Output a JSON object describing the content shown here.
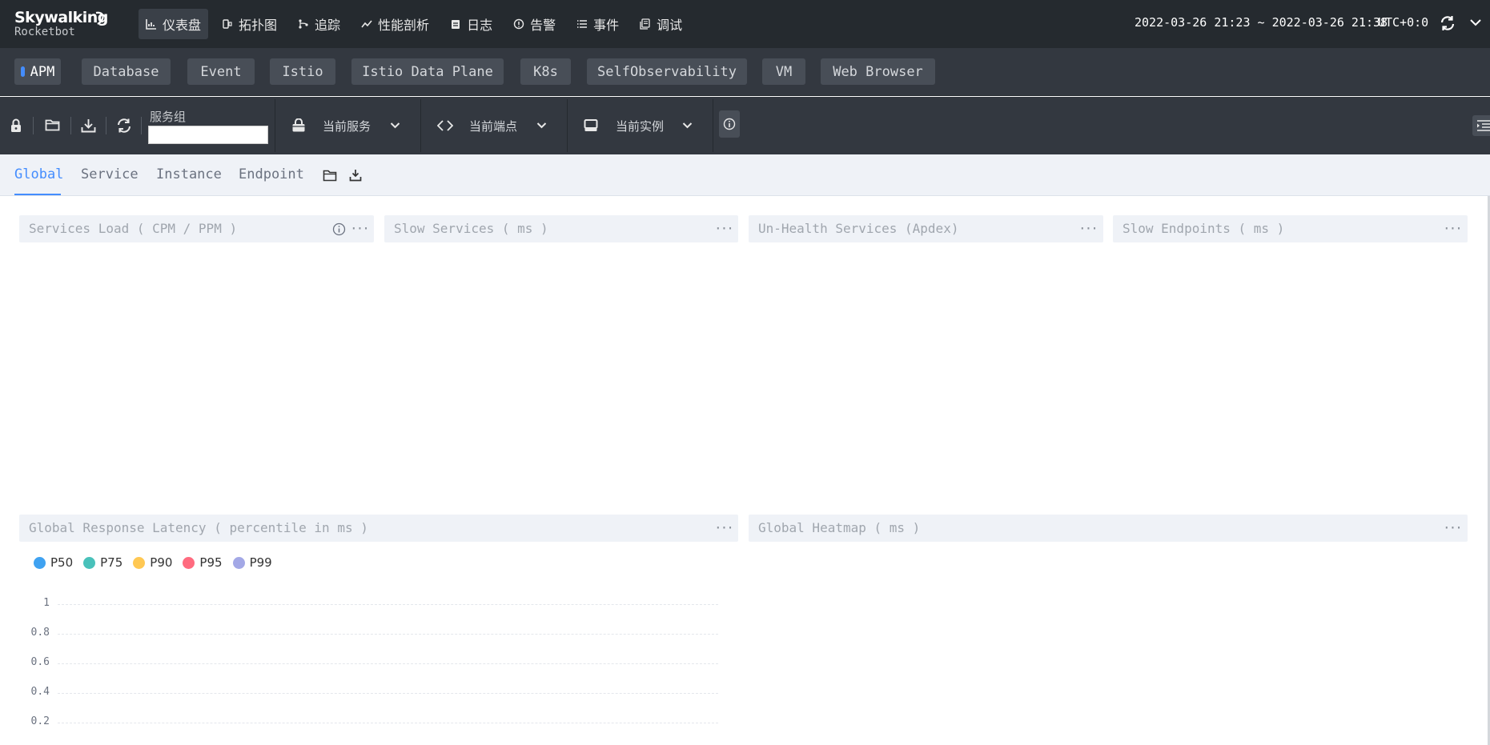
{
  "app": {
    "logo_main": "Skywalking",
    "logo_sub": "Rocketbot"
  },
  "nav": [
    {
      "label": "仪表盘",
      "icon": "dashboard-icon",
      "active": true
    },
    {
      "label": "拓扑图",
      "icon": "topology-icon",
      "active": false
    },
    {
      "label": "追踪",
      "icon": "trace-icon",
      "active": false
    },
    {
      "label": "性能剖析",
      "icon": "profile-icon",
      "active": false
    },
    {
      "label": "日志",
      "icon": "log-icon",
      "active": false
    },
    {
      "label": "告警",
      "icon": "alarm-icon",
      "active": false
    },
    {
      "label": "事件",
      "icon": "event-icon",
      "active": false
    },
    {
      "label": "调试",
      "icon": "debug-icon",
      "active": false
    }
  ],
  "header": {
    "time_range": "2022-03-26 21:23 ~ 2022-03-26 21:38",
    "timezone": "UTC+0:0"
  },
  "layers": [
    {
      "label": "APM",
      "active": true
    },
    {
      "label": "Database",
      "active": false
    },
    {
      "label": "Event",
      "active": false
    },
    {
      "label": "Istio",
      "active": false
    },
    {
      "label": "Istio Data Plane",
      "active": false
    },
    {
      "label": "K8s",
      "active": false
    },
    {
      "label": "SelfObservability",
      "active": false
    },
    {
      "label": "VM",
      "active": false
    },
    {
      "label": "Web Browser",
      "active": false
    }
  ],
  "toolbar": {
    "service_group_label": "服务组",
    "service_group_value": "",
    "current_service": "当前服务",
    "current_endpoint": "当前端点",
    "current_instance": "当前实例"
  },
  "dash_tabs": [
    {
      "label": "Global",
      "active": true
    },
    {
      "label": "Service",
      "active": false
    },
    {
      "label": "Instance",
      "active": false
    },
    {
      "label": "Endpoint",
      "active": false
    }
  ],
  "panels": {
    "services_load": "Services Load ( CPM / PPM )",
    "slow_services": "Slow Services ( ms )",
    "unhealth_services": "Un-Health Services (Apdex)",
    "slow_endpoints": "Slow Endpoints ( ms )",
    "global_latency": "Global Response Latency ( percentile in ms )",
    "global_heatmap": "Global Heatmap ( ms )",
    "more_glyph": "···"
  },
  "colors": {
    "accent": "#448dfe",
    "topbar": "#252a2f",
    "bar": "#333840"
  },
  "chart_data": {
    "type": "line",
    "title": "Global Response Latency ( percentile in ms )",
    "series": [
      {
        "name": "P50",
        "color": "#3fa2f1",
        "values": []
      },
      {
        "name": "P75",
        "color": "#49c1ba",
        "values": []
      },
      {
        "name": "P90",
        "color": "#ffc853",
        "values": []
      },
      {
        "name": "P95",
        "color": "#ff6b7f",
        "values": []
      },
      {
        "name": "P99",
        "color": "#a3a8e6",
        "values": []
      }
    ],
    "y_ticks": [
      "1",
      "0.8",
      "0.6",
      "0.4",
      "0.2"
    ],
    "ylim": [
      0,
      1
    ],
    "grid": true,
    "legend": "top-left"
  }
}
